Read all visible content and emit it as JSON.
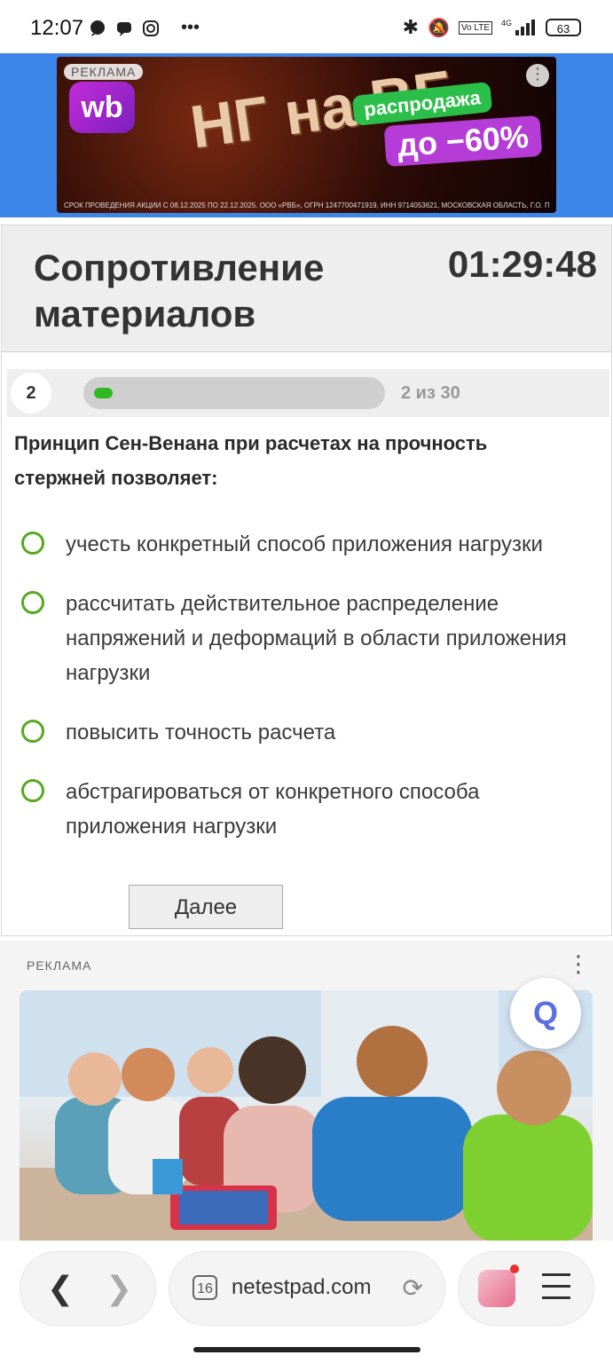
{
  "status_bar": {
    "time": "12:07",
    "battery": "63",
    "icons": [
      "chat-icon",
      "chat2-icon",
      "instagram-icon",
      "more-icon",
      "bluetooth-icon",
      "mute-icon",
      "volte-icon",
      "signal-icon",
      "battery-icon"
    ]
  },
  "top_ad": {
    "label": "РЕКЛАМА",
    "brand": "wb",
    "headline": "НГ на ВБ",
    "sale": "распродажа",
    "discount": "до −60%",
    "fine_print": "СРОК ПРОВЕДЕНИЯ АКЦИИ С 08.12.2025 ПО 22.12.2025. ООО «РВБ», ОГРН 1247700471919, ИНН 9714053621, МОСКОВСКАЯ ОБЛАСТЬ, Г.О. ПОДОЛЬСК, Д. КОЛЕДИНО"
  },
  "test": {
    "title": "Сопротивление материалов",
    "timer": "01:29:48",
    "question_number": "2",
    "progress_label": "2 из 30",
    "progress_fraction": 0.0667,
    "question": "Принцип Сен-Венана при расчетах на прочность стержней позволяет:",
    "options": [
      "учесть конкретный способ приложения нагрузки",
      "рассчитать действительное распределение напряжений и деформаций в области приложения нагрузки",
      "повысить точность расчета",
      "абстрагироваться от конкретного способа приложения нагрузки"
    ],
    "next_button": "Далее"
  },
  "bottom_ad": {
    "label": "РЕКЛАМА"
  },
  "browser": {
    "tab_count": "16",
    "url": "netestpad.com"
  },
  "colors": {
    "accent_green": "#58a820",
    "progress_green": "#2fb820",
    "ad_blue": "#3b86e8"
  }
}
